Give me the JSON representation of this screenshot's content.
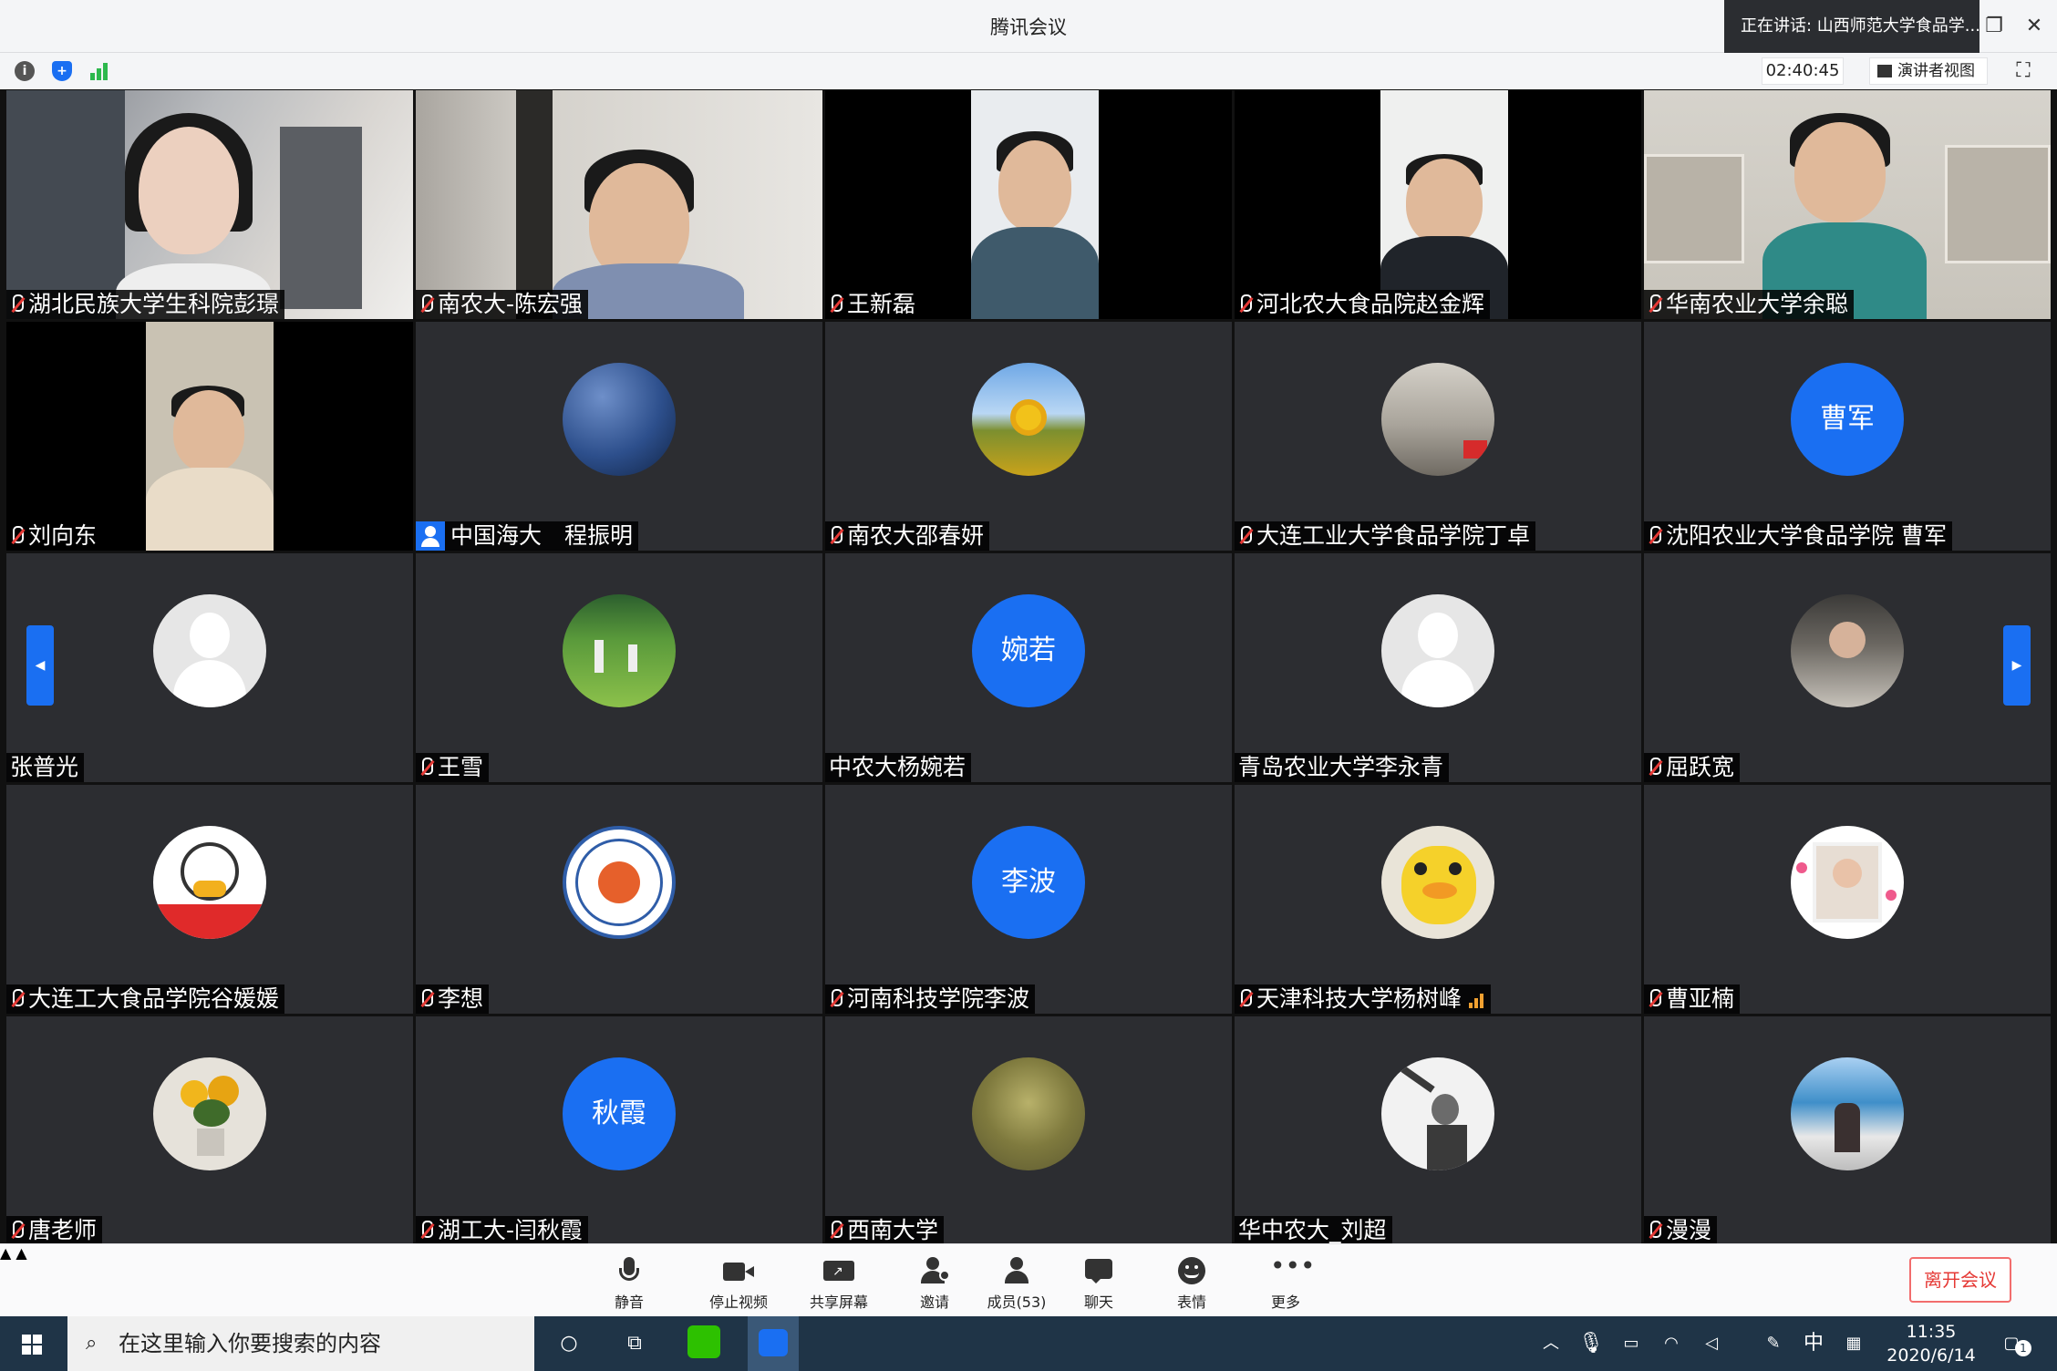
{
  "window": {
    "title": "腾讯会议",
    "speaking": "正在讲话: 山西师范大学食品学...",
    "restore_icon": "restore-icon",
    "close_icon": "close-icon"
  },
  "infobar": {
    "timer": "02:40:45",
    "view_label": "演讲者视图"
  },
  "participants": [
    {
      "name": "湖北民族大学生科院彭璟",
      "type": "video",
      "muted": true
    },
    {
      "name": "南农大-陈宏强",
      "type": "video",
      "muted": true
    },
    {
      "name": "王新磊",
      "type": "video",
      "muted": true
    },
    {
      "name": "河北农大食品院赵金辉",
      "type": "video",
      "muted": true
    },
    {
      "name": "华南农业大学余聪",
      "type": "video",
      "muted": true
    },
    {
      "name": "刘向东",
      "type": "video",
      "muted": true
    },
    {
      "name": "中国海大　程振明",
      "type": "avatar-image",
      "muted": false,
      "phone": true
    },
    {
      "name": "南农大邵春妍",
      "type": "avatar-image",
      "muted": true
    },
    {
      "name": "大连工业大学食品学院丁卓",
      "type": "avatar-image",
      "muted": true
    },
    {
      "name": "沈阳农业大学食品学院 曹军",
      "type": "avatar-initials",
      "initials": "曹军",
      "muted": true
    },
    {
      "name": "张普光",
      "type": "avatar-default",
      "muted": false
    },
    {
      "name": "王雪",
      "type": "avatar-image",
      "muted": true
    },
    {
      "name": "中农大杨婉若",
      "type": "avatar-initials",
      "initials": "婉若",
      "muted": false
    },
    {
      "name": "青岛农业大学李永青",
      "type": "avatar-default",
      "muted": false
    },
    {
      "name": "屈跃宽",
      "type": "avatar-image",
      "muted": true
    },
    {
      "name": "大连工大食品学院谷媛媛",
      "type": "avatar-image",
      "muted": true
    },
    {
      "name": "李想",
      "type": "avatar-image",
      "muted": true
    },
    {
      "name": "河南科技学院李波",
      "type": "avatar-initials",
      "initials": "李波",
      "muted": true
    },
    {
      "name": "天津科技大学杨树峰",
      "type": "avatar-image",
      "muted": true,
      "signal": true
    },
    {
      "name": "曹亚楠",
      "type": "avatar-image",
      "muted": true
    },
    {
      "name": "唐老师",
      "type": "avatar-image",
      "muted": true
    },
    {
      "name": "湖工大-闫秋霞",
      "type": "avatar-initials",
      "initials": "秋霞",
      "muted": true
    },
    {
      "name": "西南大学",
      "type": "avatar-image",
      "muted": true
    },
    {
      "name": "华中农大_刘超",
      "type": "avatar-image",
      "muted": false
    },
    {
      "name": "漫漫",
      "type": "avatar-image",
      "muted": true
    }
  ],
  "toolbar": {
    "mute": "静音",
    "stop_video": "停止视频",
    "share": "共享屏幕",
    "invite": "邀请",
    "members": "成员(53)",
    "chat": "聊天",
    "reactions": "表情",
    "more": "更多",
    "leave": "离开会议"
  },
  "taskbar": {
    "search_placeholder": "在这里输入你要搜索的内容",
    "ime": "中",
    "time": "11:35",
    "date": "2020/6/14",
    "notifications": "1"
  },
  "colors": {
    "accent": "#1a6ff2",
    "leave": "#e53935",
    "tile_bg": "#2c2d31"
  }
}
